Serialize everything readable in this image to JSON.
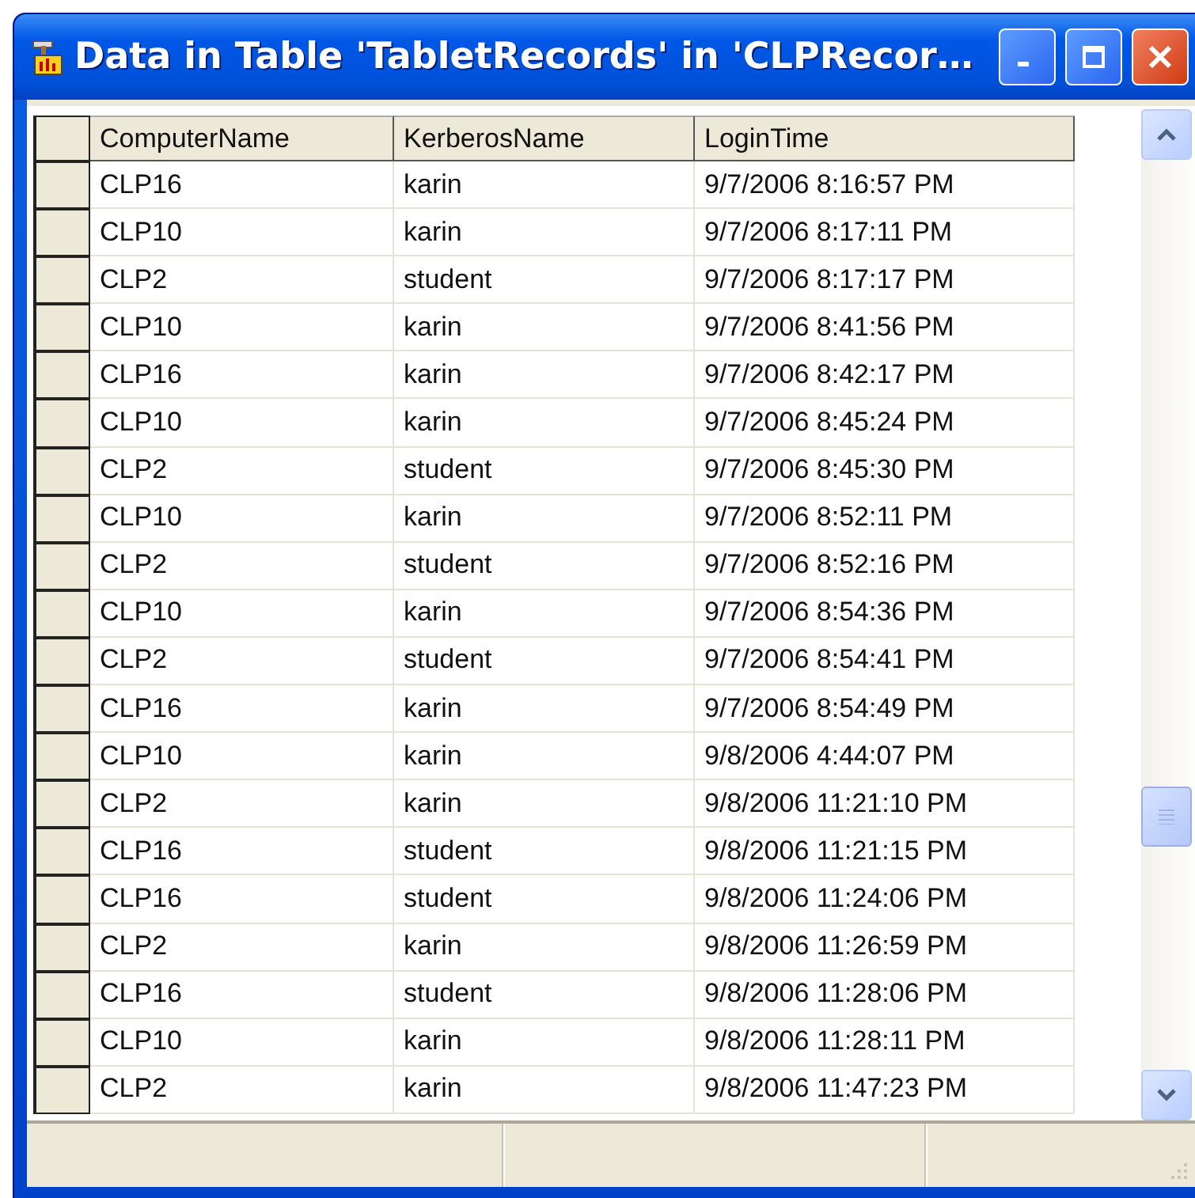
{
  "window": {
    "title": "Data in Table 'TabletRecords' in 'CLPRecor…"
  },
  "table": {
    "columns": [
      "ComputerName",
      "KerberosName",
      "LoginTime"
    ],
    "rows": [
      [
        "CLP16",
        "karin",
        "9/7/2006 8:16:57 PM"
      ],
      [
        "CLP10",
        "karin",
        "9/7/2006 8:17:11 PM"
      ],
      [
        "CLP2",
        "student",
        "9/7/2006 8:17:17 PM"
      ],
      [
        "CLP10",
        "karin",
        "9/7/2006 8:41:56 PM"
      ],
      [
        "CLP16",
        "karin",
        "9/7/2006 8:42:17 PM"
      ],
      [
        "CLP10",
        "karin",
        "9/7/2006 8:45:24 PM"
      ],
      [
        "CLP2",
        "student",
        "9/7/2006 8:45:30 PM"
      ],
      [
        "CLP10",
        "karin",
        "9/7/2006 8:52:11 PM"
      ],
      [
        "CLP2",
        "student",
        "9/7/2006 8:52:16 PM"
      ],
      [
        "CLP10",
        "karin",
        "9/7/2006 8:54:36 PM"
      ],
      [
        "CLP2",
        "student",
        "9/7/2006 8:54:41 PM"
      ],
      [
        "CLP16",
        "karin",
        "9/7/2006 8:54:49 PM"
      ],
      [
        "CLP10",
        "karin",
        "9/8/2006 4:44:07 PM"
      ],
      [
        "CLP2",
        "karin",
        "9/8/2006 11:21:10 PM"
      ],
      [
        "CLP16",
        "student",
        "9/8/2006 11:21:15 PM"
      ],
      [
        "CLP16",
        "student",
        "9/8/2006 11:24:06 PM"
      ],
      [
        "CLP2",
        "karin",
        "9/8/2006 11:26:59 PM"
      ],
      [
        "CLP16",
        "student",
        "9/8/2006 11:28:06 PM"
      ],
      [
        "CLP10",
        "karin",
        "9/8/2006 11:28:11 PM"
      ],
      [
        "CLP2",
        "karin",
        "9/8/2006 11:47:23 PM"
      ]
    ]
  }
}
